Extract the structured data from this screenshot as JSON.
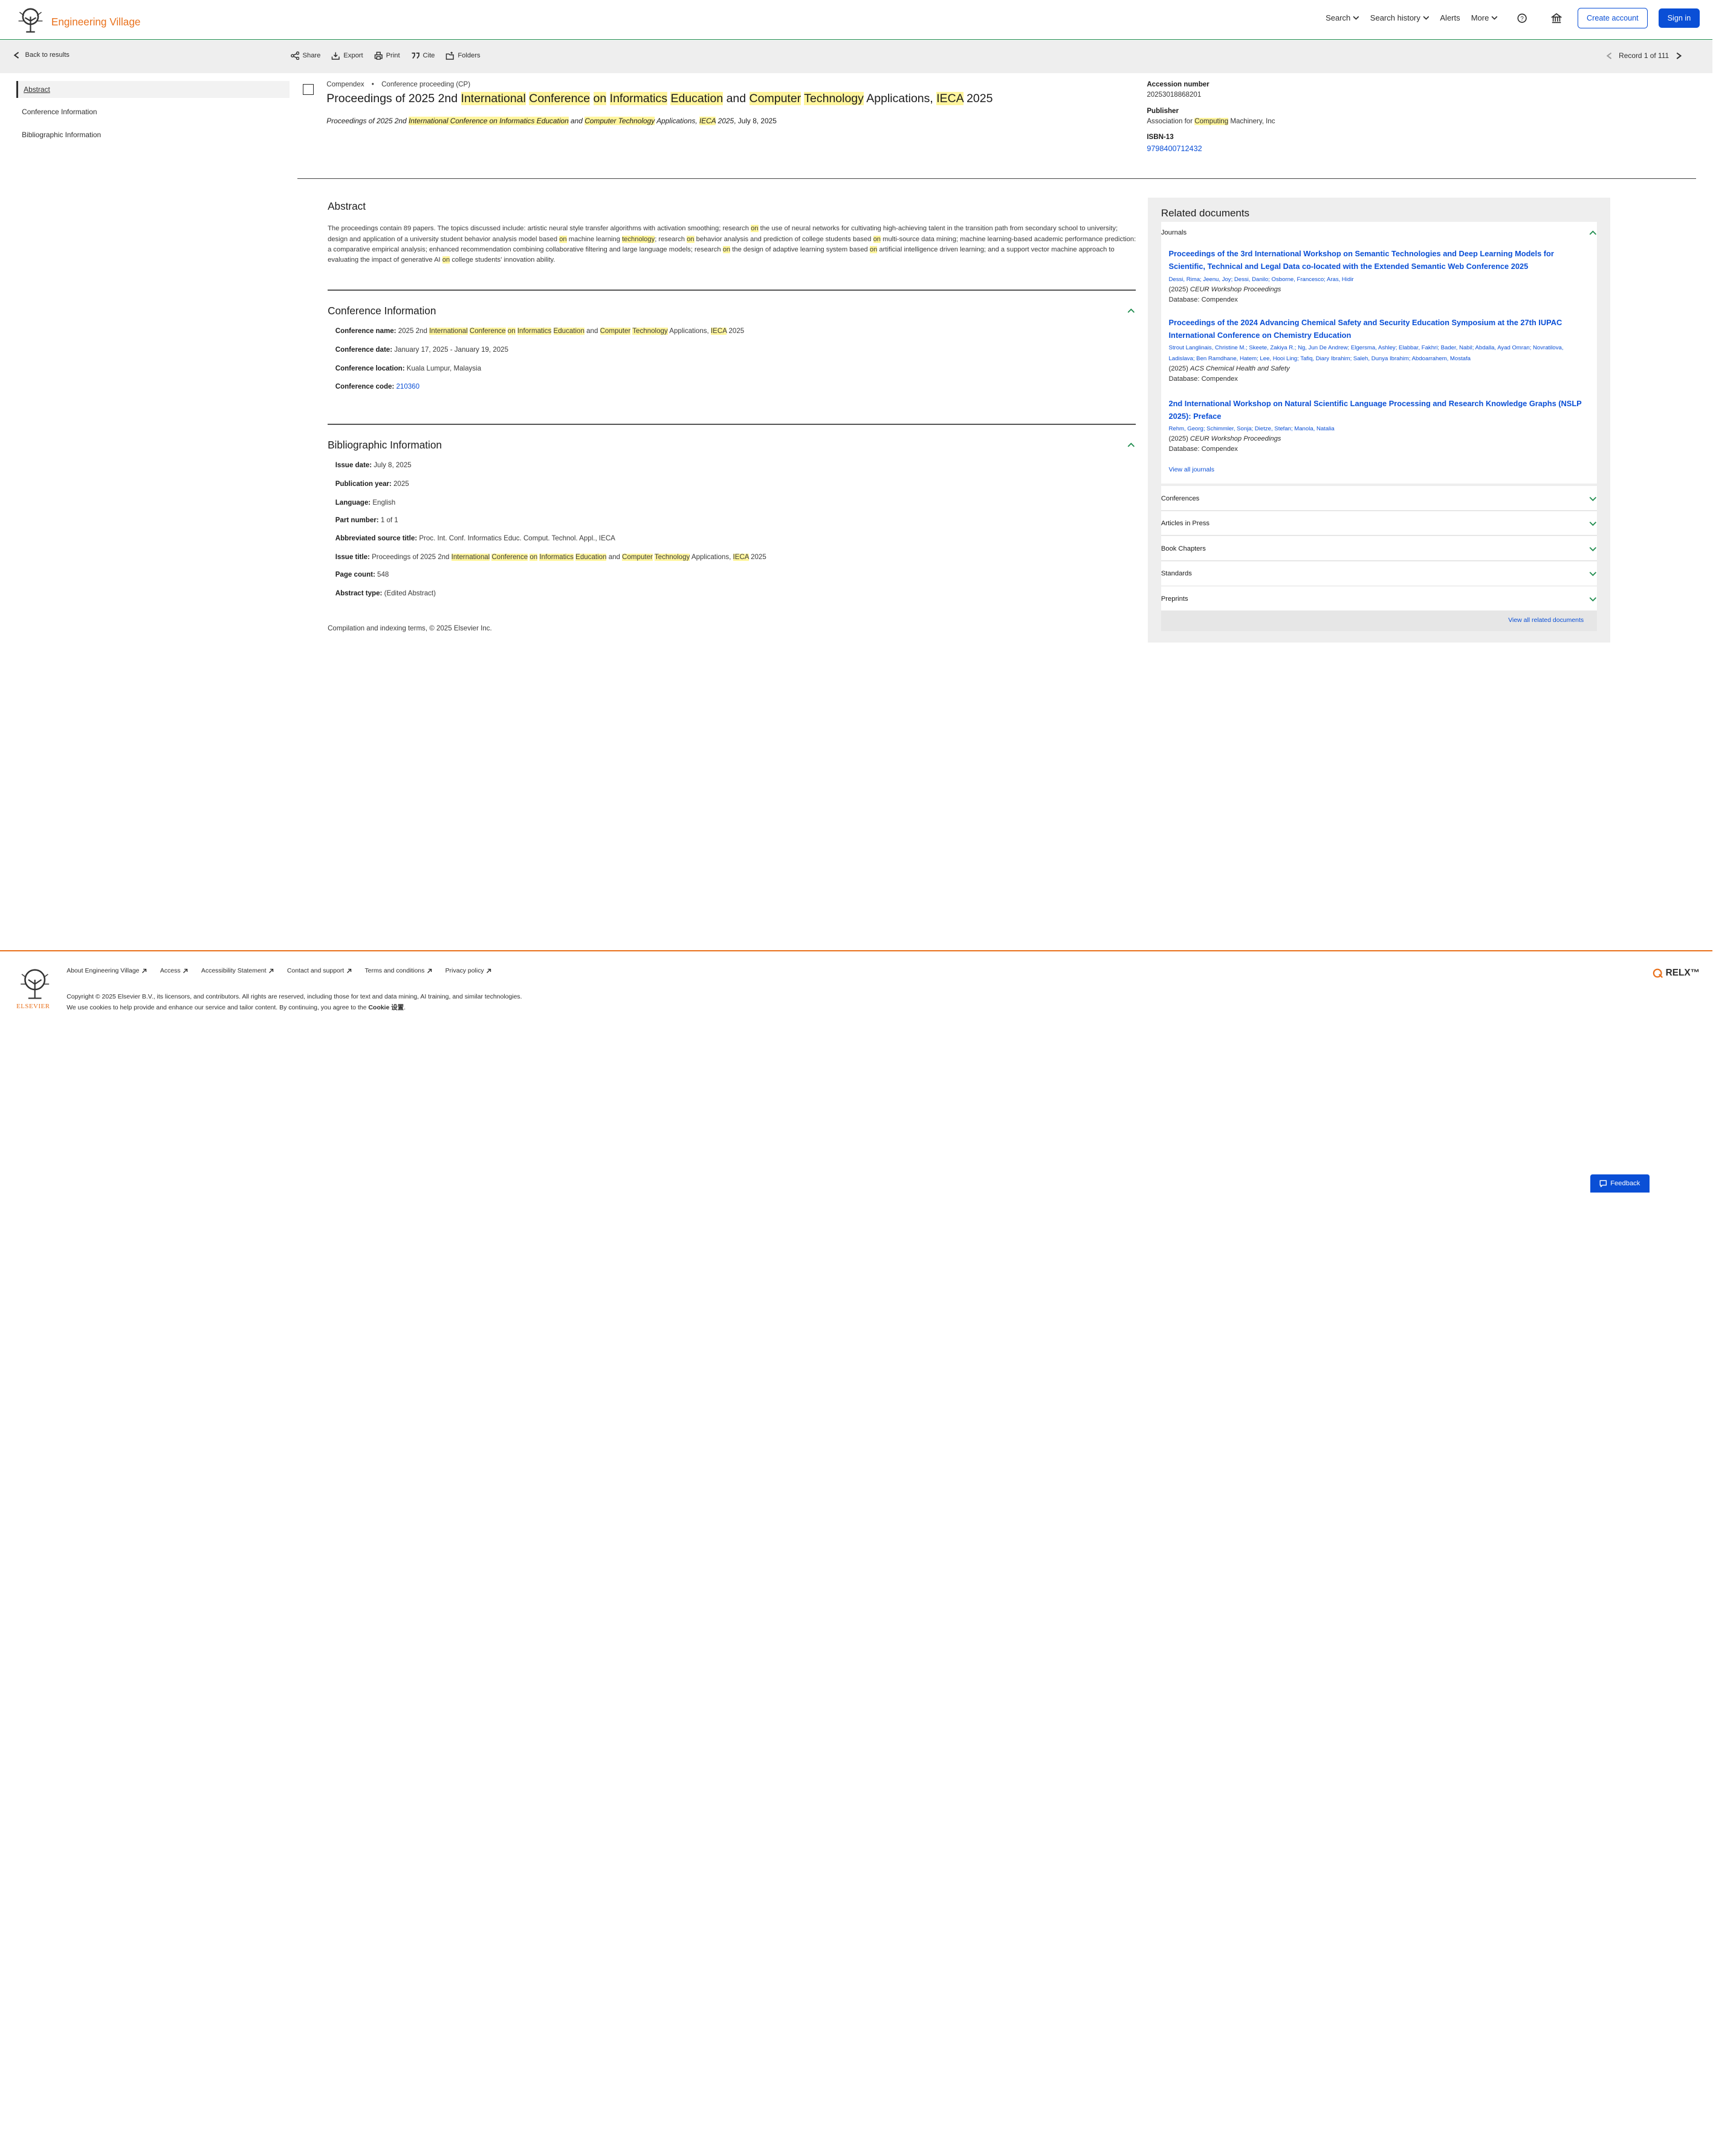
{
  "header": {
    "brand": "Engineering Village",
    "nav": [
      "Search",
      "Search history",
      "Alerts",
      "More"
    ],
    "create_account": "Create account",
    "sign_in": "Sign in"
  },
  "toolbar": {
    "back": "Back to results",
    "tools": [
      "Share",
      "Export",
      "Print",
      "Cite",
      "Folders"
    ],
    "record": "Record 1 of 111"
  },
  "toc": [
    "Abstract",
    "Conference Information",
    "Bibliographic Information"
  ],
  "doc": {
    "database": "Compendex",
    "bullet": "•",
    "doc_type": "Conference proceeding (CP)",
    "title_parts": [
      "Proceedings of 2025 2nd ",
      "International",
      " ",
      "Conference",
      " ",
      "on",
      " ",
      "Informatics",
      " ",
      "Education",
      " and ",
      "Computer",
      " ",
      "Technology",
      " Applications, ",
      "IECA",
      " 2025"
    ],
    "subtitle_parts": [
      "Proceedings of 2025 2nd ",
      "International Conference on Informatics Education",
      " and ",
      "Computer Technology",
      " Applications, ",
      "IECA",
      " 2025",
      ", July 8, 2025"
    ]
  },
  "side_meta": {
    "accession_label": "Accession number",
    "accession": "20253018868201",
    "publisher_label": "Publisher",
    "publisher_parts": [
      "Association for ",
      "Computing",
      " Machinery, Inc"
    ],
    "isbn_label": "ISBN-13",
    "isbn": "9798400712432"
  },
  "abstract": {
    "title": "Abstract",
    "text_parts": [
      "The proceedings contain 89 papers. The topics discussed include: artistic neural style transfer algorithms with activation smoothing; research ",
      "on",
      " the use of neural networks for cultivating high-achieving talent in the transition path from secondary school to university; design and application of a university student behavior analysis model based ",
      "on",
      " machine learning ",
      "technology",
      "; research ",
      "on",
      " behavior analysis and prediction of college students based ",
      "on",
      " multi-source data mining; machine learning-based academic performance prediction: a comparative empirical analysis; enhanced recommendation combining collaborative filtering and large language models; research ",
      "on",
      " the design of adaptive learning system based ",
      "on",
      " artificial intelligence driven learning; and a support vector machine approach to evaluating the impact of generative AI ",
      "on",
      " college students' innovation ability."
    ]
  },
  "conference": {
    "title": "Conference Information",
    "name_label": "Conference name:",
    "name_parts": [
      "2025 2nd ",
      "International",
      " ",
      "Conference",
      " ",
      "on",
      " ",
      "Informatics",
      " ",
      "Education",
      " and ",
      "Computer",
      " ",
      "Technology",
      " Applications, ",
      "IECA",
      " 2025"
    ],
    "date_label": "Conference date:",
    "date": "January 17, 2025 - January 19, 2025",
    "location_label": "Conference location:",
    "location": "Kuala Lumpur, Malaysia",
    "code_label": "Conference code:",
    "code": "210360"
  },
  "bibliographic": {
    "title": "Bibliographic Information",
    "issue_date_label": "Issue date:",
    "issue_date": "July 8, 2025",
    "pub_year_label": "Publication year:",
    "pub_year": "2025",
    "language_label": "Language:",
    "language": "English",
    "part_number_label": "Part number:",
    "part_number": "1 of 1",
    "abbrev_label": "Abbreviated source title:",
    "abbrev": "Proc. Int. Conf. Informatics Educ. Comput. Technol. Appl., IECA",
    "issue_title_label": "Issue title:",
    "issue_title_parts": [
      "Proceedings of 2025 2nd ",
      "International",
      " ",
      "Conference",
      " ",
      "on",
      " ",
      "Informatics",
      " ",
      "Education",
      " and ",
      "Computer",
      " ",
      "Technology",
      " Applications, ",
      "IECA",
      " 2025"
    ],
    "page_count_label": "Page count:",
    "page_count": "548",
    "abstract_type_label": "Abstract type:",
    "abstract_type": "(Edited Abstract)"
  },
  "compilation": "Compilation and indexing terms, © 2025 Elsevier Inc.",
  "related": {
    "title": "Related documents",
    "journals_label": "Journals",
    "items": [
      {
        "title": "Proceedings of the 3rd International Workshop on Semantic Technologies and Deep Learning Models for Scientific, Technical and Legal Data co-located with the Extended Semantic Web Conference 2025",
        "authors": "Dessi, Rima; Jeenu, Joy; Dessi, Danilo; Osborne, Francesco; Aras, Hidir",
        "year": "(2025)",
        "source": "CEUR Workshop Proceedings",
        "database": "Database: Compendex"
      },
      {
        "title": "Proceedings of the 2024 Advancing Chemical Safety and Security Education Symposium at the 27th IUPAC International Conference on Chemistry Education",
        "authors": "Strout Langlinais, Christine M.; Skeete, Zakiya R.; Ng, Jun De Andrew; Elgersma, Ashley; Elabbar, Fakhri; Bader, Nabil; Abdalla, Ayad Omran; Novratilova, Ladislava; Ben Ramdhane, Hatem; Lee, Hooi Ling; Tafiq, Diary Ibrahim; Saleh, Dunya Ibrahim; Abdoarrahem, Mostafa",
        "year": "(2025)",
        "source": "ACS Chemical Health and Safety",
        "database": "Database: Compendex"
      },
      {
        "title": "2nd International Workshop on Natural Scientific Language Processing and Research Knowledge Graphs (NSLP 2025): Preface",
        "authors": "Rehm, Georg; Schimmler, Sonja; Dietze, Stefan; Manola, Natalia",
        "year": "(2025)",
        "source": "CEUR Workshop Proceedings",
        "database": "Database: Compendex"
      }
    ],
    "view_all_journals": "View all journals",
    "other_sections": [
      "Conferences",
      "Articles in Press",
      "Book Chapters",
      "Standards",
      "Preprints"
    ],
    "view_all_related": "View all related documents"
  },
  "footer": {
    "links": [
      "About Engineering Village",
      "Access",
      "Accessibility Statement",
      "Contact and support",
      "Terms and conditions",
      "Privacy policy"
    ],
    "copyright": "Copyright © 2025 Elsevier B.V., its licensors, and contributors. All rights are reserved, including those for text and data mining, AI training, and similar technologies.",
    "cookie_pre": "We use cookies to help provide and enhance our service and tailor content. By continuing, you agree to the ",
    "cookie_link": "Cookie 设置",
    "cookie_post": ".",
    "elsevier": "ELSEVIER",
    "relx": "RELX™",
    "feedback": "Feedback"
  }
}
